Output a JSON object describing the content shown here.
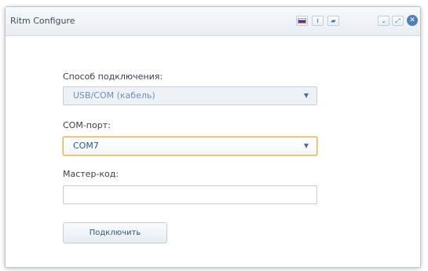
{
  "window": {
    "title": "Ritm Configure"
  },
  "toolbar": {
    "language_flag": "russia-flag-icon",
    "upload_icon": "upload-icon",
    "folder_icon": "folder-icon",
    "minimize_icon": "chevron-down-icon",
    "maximize_icon": "maximize-icon",
    "close_icon": "close-icon",
    "upload_glyph": "⭱",
    "folder_glyph": "▰",
    "minimize_glyph": "⌄",
    "maximize_glyph": "⤢",
    "close_glyph": "✕"
  },
  "form": {
    "connection_label": "Способ подключения:",
    "connection_value": "USB/COM (кабель)",
    "port_label": "COM-порт:",
    "port_value": "COM7",
    "master_code_label": "Мастер-код:",
    "master_code_value": "",
    "connect_button": "Подключить",
    "dropdown_arrow": "▼"
  },
  "colors": {
    "accent": "#3c74b4",
    "focus_border": "#e0b35c"
  }
}
